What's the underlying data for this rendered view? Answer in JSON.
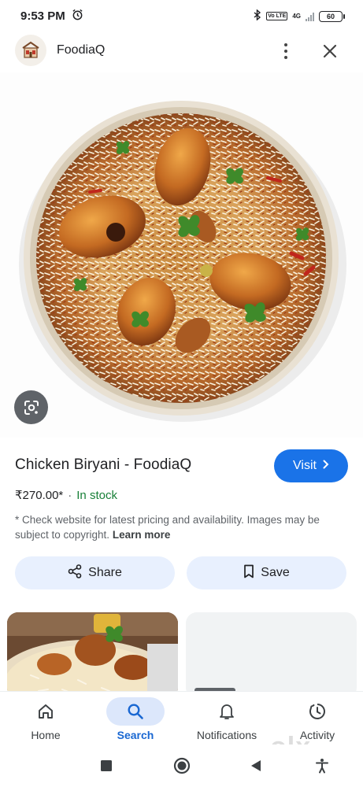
{
  "status_bar": {
    "time": "9:53 PM",
    "network": "4G",
    "lte": "Vo LTE",
    "battery": "60"
  },
  "header": {
    "site_name": "FoodiaQ",
    "logo_icon": "restaurant-logo-icon",
    "more_icon": "more-vert-icon",
    "close_icon": "close-icon"
  },
  "image": {
    "subject": "biryani-bowl-image",
    "lens_icon": "google-lens-icon"
  },
  "product": {
    "title": "Chicken Biryani - FoodiaQ",
    "visit_label": "Visit",
    "price": "₹270.00*",
    "separator": "·",
    "stock": "In stock",
    "disclaimer": "* Check website for latest pricing and availability. Images may be subject to copyright.",
    "learn_more": "Learn more",
    "share_label": "Share",
    "save_label": "Save"
  },
  "bottom_nav": {
    "items": [
      {
        "label": "Home",
        "icon": "home-icon"
      },
      {
        "label": "Search",
        "icon": "search-icon",
        "active": true
      },
      {
        "label": "Notifications",
        "icon": "bell-icon"
      },
      {
        "label": "Activity",
        "icon": "activity-icon"
      }
    ]
  },
  "watermark": "olx",
  "colors": {
    "accent": "#1a73e8",
    "in_stock": "#188038",
    "chip_bg": "#e8f0fe"
  }
}
